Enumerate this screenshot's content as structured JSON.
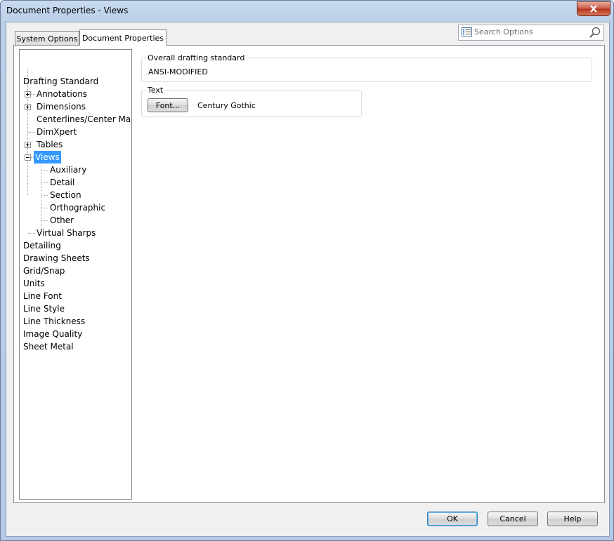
{
  "window": {
    "title": "Document Properties - Views"
  },
  "tabs": [
    {
      "label": "System Options"
    },
    {
      "label": "Document Properties"
    }
  ],
  "search": {
    "placeholder": "Search Options"
  },
  "tree": {
    "items": [
      {
        "label": "Drafting Standard"
      },
      {
        "label": "Annotations"
      },
      {
        "label": "Dimensions"
      },
      {
        "label": "Centerlines/Center Marks"
      },
      {
        "label": "DimXpert"
      },
      {
        "label": "Tables"
      },
      {
        "label": "Views"
      },
      {
        "label": "Auxiliary"
      },
      {
        "label": "Detail"
      },
      {
        "label": "Section"
      },
      {
        "label": "Orthographic"
      },
      {
        "label": "Other"
      },
      {
        "label": "Virtual Sharps"
      },
      {
        "label": "Detailing"
      },
      {
        "label": "Drawing Sheets"
      },
      {
        "label": "Grid/Snap"
      },
      {
        "label": "Units"
      },
      {
        "label": "Line Font"
      },
      {
        "label": "Line Style"
      },
      {
        "label": "Line Thickness"
      },
      {
        "label": "Image Quality"
      },
      {
        "label": "Sheet Metal"
      }
    ]
  },
  "drafting_group": {
    "title": "Overall drafting standard",
    "value": "ANSI-MODIFIED"
  },
  "text_group": {
    "title": "Text",
    "font_button": "Font...",
    "font_value": "Century Gothic"
  },
  "buttons": {
    "ok": "OK",
    "cancel": "Cancel",
    "help": "Help"
  },
  "colors": {
    "selection": "#3399ff",
    "close_button": "#c85a45"
  },
  "icons": [
    "close-icon",
    "options-list-icon",
    "search-icon",
    "expand-plus-icon",
    "collapse-minus-icon"
  ]
}
